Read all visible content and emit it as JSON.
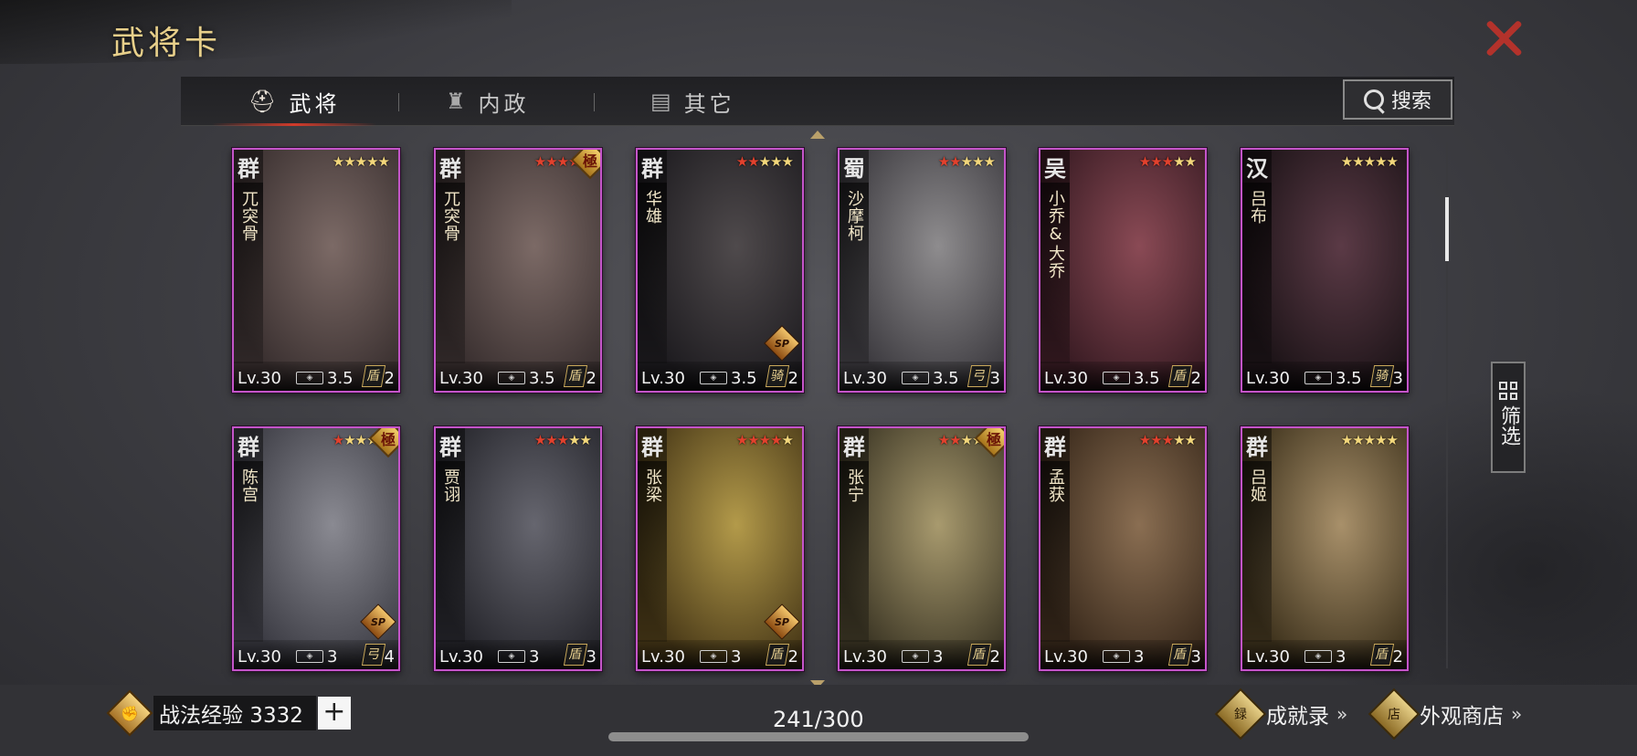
{
  "title": "武将卡",
  "tabs": [
    {
      "label": "武将",
      "icon": "helmet-icon",
      "active": true
    },
    {
      "label": "内政",
      "icon": "pillar-icon",
      "active": false
    },
    {
      "label": "其它",
      "icon": "chest-icon",
      "active": false
    }
  ],
  "search": {
    "label": "搜索"
  },
  "filter": {
    "label": "筛选"
  },
  "cards": [
    {
      "faction": "群",
      "name": "兀突骨",
      "stars_red": 0,
      "stars": 5,
      "level": "Lv.30",
      "cost": "3.5",
      "arms_icon": "shield-icon",
      "arms_glyph": "盾",
      "arms_count": "2",
      "ji": false,
      "sp": false,
      "tone": [
        "#7c6a66",
        "#3a3030"
      ]
    },
    {
      "faction": "群",
      "name": "兀突骨",
      "stars_red": 5,
      "stars": 5,
      "level": "Lv.30",
      "cost": "3.5",
      "arms_icon": "shield-icon",
      "arms_glyph": "盾",
      "arms_count": "2",
      "ji": true,
      "ji_label": "極",
      "sp": false,
      "tone": [
        "#7c6a66",
        "#3a3030"
      ]
    },
    {
      "faction": "群",
      "name": "华雄",
      "stars_red": 2,
      "stars": 5,
      "level": "Lv.30",
      "cost": "3.5",
      "arms_icon": "cavalry-icon",
      "arms_glyph": "骑",
      "arms_count": "2",
      "ji": false,
      "sp": true,
      "sp_label": "SP",
      "tone": [
        "#4f4a4c",
        "#1e1c20"
      ]
    },
    {
      "faction": "蜀",
      "name": "沙摩柯",
      "stars_red": 2,
      "stars": 5,
      "level": "Lv.30",
      "cost": "3.5",
      "arms_icon": "bow-icon",
      "arms_glyph": "弓",
      "arms_count": "3",
      "ji": false,
      "sp": false,
      "tone": [
        "#8e8c8e",
        "#3d3b40"
      ]
    },
    {
      "faction": "吴",
      "name": "小乔&大乔",
      "stars_red": 3,
      "stars": 5,
      "level": "Lv.30",
      "cost": "3.5",
      "arms_icon": "shield-icon",
      "arms_glyph": "盾",
      "arms_count": "2",
      "ji": false,
      "sp": false,
      "tone": [
        "#8a4a55",
        "#3a1c24"
      ]
    },
    {
      "faction": "汉",
      "name": "吕布",
      "stars_red": 0,
      "stars": 5,
      "level": "Lv.30",
      "cost": "3.5",
      "arms_icon": "cavalry-icon",
      "arms_glyph": "骑",
      "arms_count": "3",
      "ji": false,
      "sp": false,
      "tone": [
        "#5b3a46",
        "#1d1418"
      ]
    },
    {
      "faction": "群",
      "name": "陈宫",
      "stars_red": 1,
      "stars": 5,
      "level": "Lv.30",
      "cost": "3",
      "arms_icon": "bow-icon",
      "arms_glyph": "弓",
      "arms_count": "4",
      "ji": true,
      "ji_label": "極",
      "sp": true,
      "sp_label": "SP",
      "tone": [
        "#8a8a92",
        "#3c3c44"
      ]
    },
    {
      "faction": "群",
      "name": "贾诩",
      "stars_red": 3,
      "stars": 5,
      "level": "Lv.30",
      "cost": "3",
      "arms_icon": "shield-icon",
      "arms_glyph": "盾",
      "arms_count": "3",
      "ji": false,
      "sp": false,
      "tone": [
        "#66666f",
        "#26262c"
      ]
    },
    {
      "faction": "群",
      "name": "张梁",
      "stars_red": 4,
      "stars": 5,
      "level": "Lv.30",
      "cost": "3",
      "arms_icon": "shield-icon",
      "arms_glyph": "盾",
      "arms_count": "2",
      "ji": false,
      "sp": true,
      "sp_label": "SP",
      "tone": [
        "#b39a4a",
        "#4a3a18"
      ]
    },
    {
      "faction": "群",
      "name": "张宁",
      "stars_red": 2,
      "stars": 5,
      "level": "Lv.30",
      "cost": "3",
      "arms_icon": "shield-icon",
      "arms_glyph": "盾",
      "arms_count": "2",
      "ji": true,
      "ji_label": "極",
      "sp": false,
      "tone": [
        "#a89a6e",
        "#3e3826"
      ]
    },
    {
      "faction": "群",
      "name": "孟获",
      "stars_red": 3,
      "stars": 5,
      "level": "Lv.30",
      "cost": "3",
      "arms_icon": "shield-icon",
      "arms_glyph": "盾",
      "arms_count": "3",
      "ji": false,
      "sp": false,
      "tone": [
        "#8a6e52",
        "#3a2a1c"
      ]
    },
    {
      "faction": "群",
      "name": "吕姬",
      "stars_red": 0,
      "stars": 5,
      "level": "Lv.30",
      "cost": "3",
      "arms_icon": "shield-icon",
      "arms_glyph": "盾",
      "arms_count": "2",
      "ji": false,
      "sp": false,
      "tone": [
        "#a8906a",
        "#40341e"
      ]
    }
  ],
  "colors": {
    "card_border": "#c455c9",
    "accent_gold": "#e7cf8a",
    "close_red": "#b3322b",
    "star_red": "#e2412d",
    "star_gold": "#f3d77b"
  },
  "footer": {
    "exp_label": "战法经验 3332",
    "plus": "+",
    "count": "241/300",
    "achievements": "成就录",
    "shop": "外观商店",
    "chevrons": "»"
  }
}
